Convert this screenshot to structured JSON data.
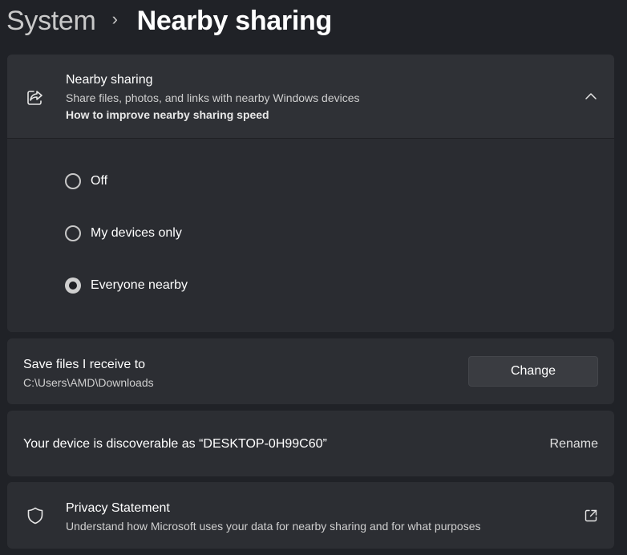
{
  "breadcrumb": {
    "parent": "System",
    "separator": "›",
    "current": "Nearby sharing"
  },
  "nearby_sharing": {
    "title": "Nearby sharing",
    "subtitle": "Share files, photos, and links with nearby Windows devices",
    "link": "How to improve nearby sharing speed",
    "icon": "share-icon",
    "expanded": true,
    "options": [
      {
        "label": "Off",
        "selected": false
      },
      {
        "label": "My devices only",
        "selected": false
      },
      {
        "label": "Everyone nearby",
        "selected": true
      }
    ]
  },
  "save_location": {
    "title": "Save files I receive to",
    "path": "C:\\Users\\AMD\\Downloads",
    "button": "Change"
  },
  "discoverable": {
    "text": "Your device is discoverable as “DESKTOP-0H99C60”",
    "button": "Rename"
  },
  "privacy": {
    "title": "Privacy Statement",
    "subtitle": "Understand how Microsoft uses your data for nearby sharing and for what purposes",
    "icon": "shield-icon",
    "link_icon": "external-link-icon"
  }
}
